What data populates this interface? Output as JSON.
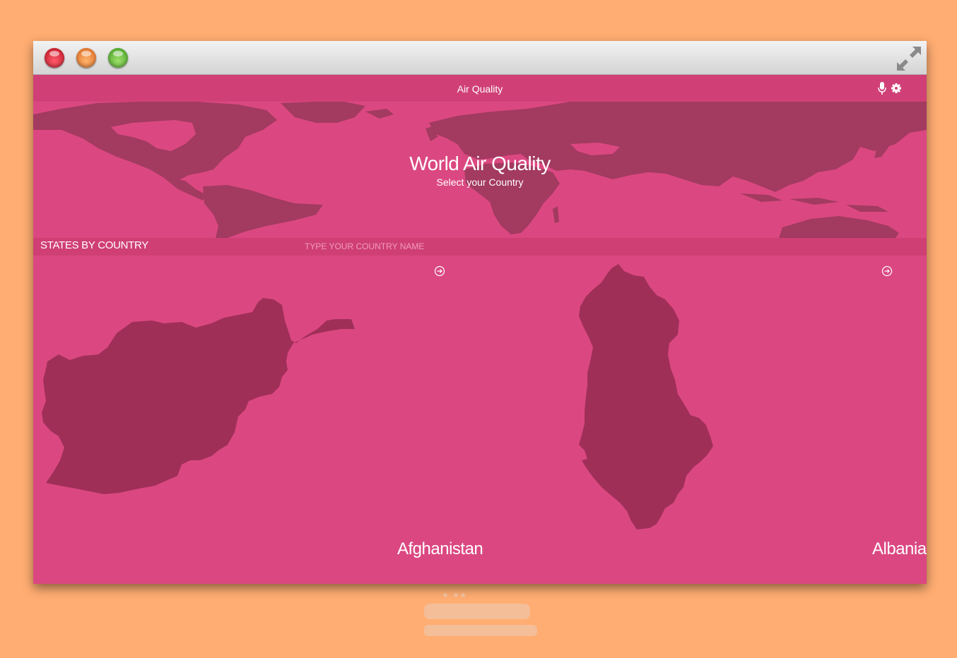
{
  "window": {
    "controls": [
      "close-icon",
      "minimize-icon",
      "zoom-icon"
    ],
    "expand_icon": "expand-icon"
  },
  "appbar": {
    "title": "Air Quality",
    "icons": [
      "microphone-icon",
      "gear-icon"
    ]
  },
  "hero": {
    "title": "World Air Quality",
    "subtitle": "Select your Country"
  },
  "search": {
    "section_title": "STATES BY COUNTRY",
    "placeholder": "TYPE YOUR COUNTRY NAME",
    "value": ""
  },
  "countries": [
    {
      "name": "Afghanistan",
      "icon": "arrow-right-circle-icon"
    },
    {
      "name": "Albania",
      "icon": "arrow-right-circle-icon"
    }
  ],
  "colors": {
    "background": "#ffad72",
    "primary": "#db4881",
    "bar": "#d04076",
    "land": "#a33a60",
    "country_fill": "#a02f58"
  }
}
